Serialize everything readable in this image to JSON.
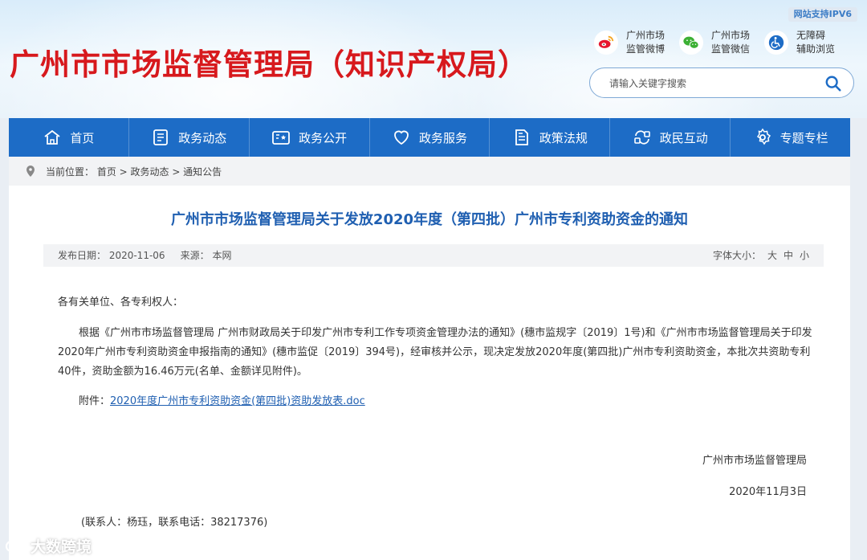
{
  "header": {
    "ipv6_badge": "网站支持IPV6",
    "site_title": "广州市市场监督管理局（知识产权局）",
    "links": [
      {
        "line1": "广州市场",
        "line2": "监管微博",
        "icon": "weibo-icon",
        "color": "#e6162d"
      },
      {
        "line1": "广州市场",
        "line2": "监管微信",
        "icon": "wechat-icon",
        "color": "#3cb034"
      },
      {
        "line1": "无障碍",
        "line2": "辅助浏览",
        "icon": "accessibility-icon",
        "color": "#1d6cc6"
      }
    ],
    "search": {
      "placeholder": "请输入关键字搜索"
    }
  },
  "nav": {
    "items": [
      {
        "label": "首页",
        "icon": "home-icon"
      },
      {
        "label": "政务动态",
        "icon": "news-icon"
      },
      {
        "label": "政务公开",
        "icon": "open-affairs-icon"
      },
      {
        "label": "政务服务",
        "icon": "heart-service-icon"
      },
      {
        "label": "政策法规",
        "icon": "document-icon"
      },
      {
        "label": "政民互动",
        "icon": "interaction-icon"
      },
      {
        "label": "专题专栏",
        "icon": "gear-topic-icon"
      }
    ],
    "color": "#1d6cc6"
  },
  "breadcrumb": {
    "text": "当前位置： 首页 > 政务动态 > 通知公告"
  },
  "article": {
    "title": "广州市市场监督管理局关于发放2020年度（第四批）广州市专利资助资金的通知",
    "publish_date": "发布日期： 2020-11-06",
    "source": "来源： 本网",
    "font_size_label": "字体大小：",
    "font_sizes": [
      "大",
      "中",
      "小"
    ],
    "greeting": "各有关单位、各专利权人：",
    "paragraph": "根据《广州市市场监督管理局 广州市财政局关于印发广州市专利工作专项资金管理办法的通知》(穗市监规字〔2019〕1号)和《广州市市场监督管理局关于印发2020年广州市专利资助资金申报指南的通知》(穗市监促〔2019〕394号)，经审核并公示，现决定发放2020年度(第四批)广州市专利资助资金，本批次共资助专利40件，资助金额为16.46万元(名单、金额详见附件)。",
    "attachment_label": "附件：",
    "attachment_link": "2020年度广州市专利资助资金(第四批)资助发放表.doc",
    "signature": "广州市市场监督管理局",
    "date": "2020年11月3日",
    "contact": "(联系人：杨珏，联系电话：38217376)"
  },
  "watermark": "大数跨境",
  "colors": {
    "title_red": "#d7191d",
    "title_blue": "#1f5fb1",
    "nav_blue": "#1d6cc6"
  }
}
